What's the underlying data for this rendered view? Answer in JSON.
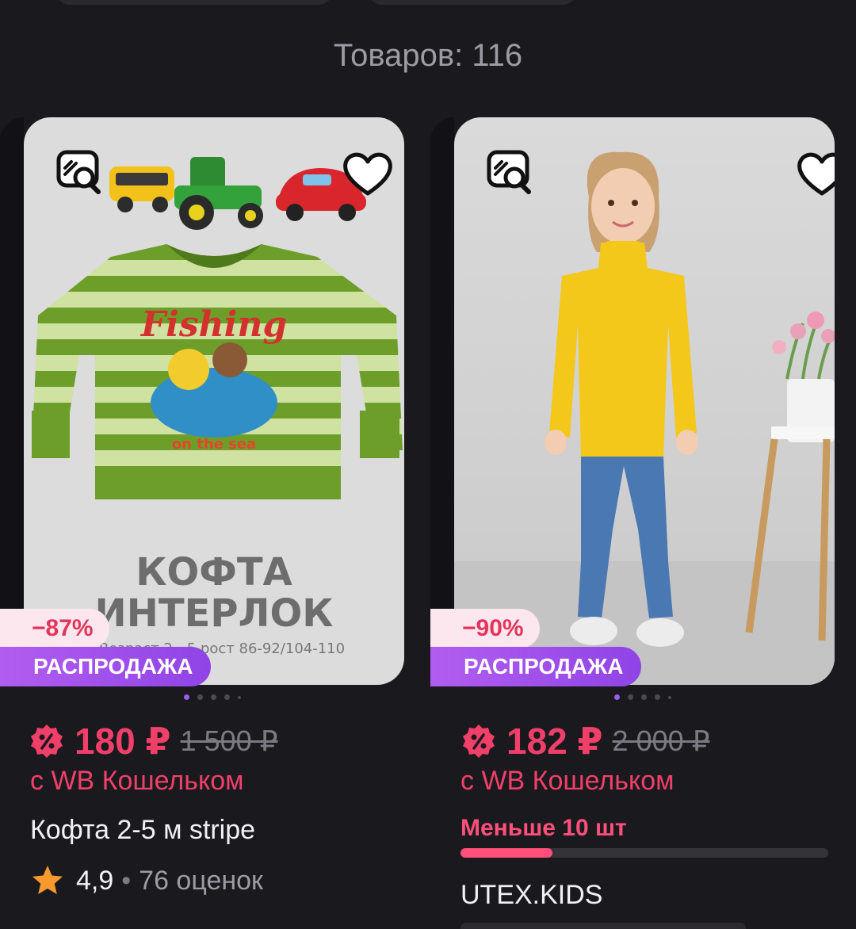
{
  "results": {
    "count_label": "Товаров: 116"
  },
  "products": [
    {
      "discount": "−87%",
      "sale_badge": "РАСПРОДАЖА",
      "price": "180 ₽",
      "old_price": "1 500 ₽",
      "wallet_label": "с WB Кошельком",
      "name": "Кофта 2-5 м stripe",
      "rating": "4,9",
      "rating_sep": "•",
      "reviews": "76 оценок",
      "image_text": {
        "print_title": "Fishing",
        "print_sub": "on the sea",
        "line1": "КОФТА",
        "line2": "ИНТЕРЛОК",
        "line3": "Возраст 2 - 5 рост 86-92/104-110"
      },
      "photo_index": 1,
      "photo_count": 5
    },
    {
      "discount": "−90%",
      "sale_badge": "РАСПРОДАЖА",
      "price": "182 ₽",
      "old_price": "2 000 ₽",
      "wallet_label": "с WB Кошельком",
      "stock_label": "Меньше 10 шт",
      "stock_level": 0.25,
      "brand": "UTEX.KIDS",
      "photo_index": 1,
      "photo_count": 5
    }
  ],
  "icons": [
    "similar-search-icon",
    "heart-icon",
    "wallet-discount-icon",
    "star-icon"
  ],
  "colors": {
    "price": "#f0406a",
    "sale": "#9b4fef",
    "discount_bg": "#fde7ef",
    "background": "#1a191e"
  }
}
